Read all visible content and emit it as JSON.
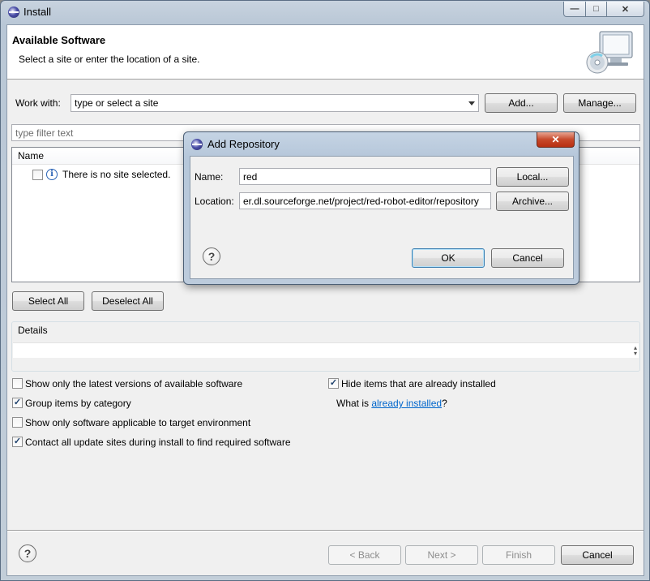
{
  "window": {
    "title": "Install",
    "minimize_glyph": "—",
    "maximize_glyph": "□",
    "close_glyph": "✕"
  },
  "header": {
    "title": "Available Software",
    "subtitle": "Select a site or enter the location of a site."
  },
  "work_with": {
    "label": "Work with:",
    "value": "type or select a site",
    "add_label": "Add...",
    "manage_label": "Manage..."
  },
  "filter": {
    "placeholder": "type filter text"
  },
  "tree": {
    "column_name": "Name",
    "empty_item": "There is no site selected."
  },
  "selection": {
    "select_all": "Select All",
    "deselect_all": "Deselect All"
  },
  "details": {
    "label": "Details"
  },
  "options": {
    "latest_versions": {
      "label": "Show only the latest versions of available software",
      "checked": false
    },
    "group_by_category": {
      "label": "Group items by category",
      "checked": true
    },
    "applicable_only": {
      "label": "Show only software applicable to target environment",
      "checked": false
    },
    "contact_all": {
      "label": "Contact all update sites during install to find required software",
      "checked": true
    },
    "hide_installed": {
      "label": "Hide items that are already installed",
      "checked": true
    },
    "what_is_prefix": "What is ",
    "what_is_link": "already installed",
    "what_is_suffix": "?"
  },
  "footer": {
    "back": "< Back",
    "next": "Next >",
    "finish": "Finish",
    "cancel": "Cancel"
  },
  "dialog": {
    "title": "Add Repository",
    "name_label": "Name:",
    "name_value": "red",
    "local_label": "Local...",
    "location_label": "Location:",
    "location_value": "er.dl.sourceforge.net/project/red-robot-editor/repository",
    "archive_label": "Archive...",
    "ok_label": "OK",
    "cancel_label": "Cancel",
    "close_glyph": "✕"
  },
  "colors": {
    "link": "#0066cc",
    "dialog_close": "#c7492b",
    "info_icon": "#2a63b5"
  }
}
